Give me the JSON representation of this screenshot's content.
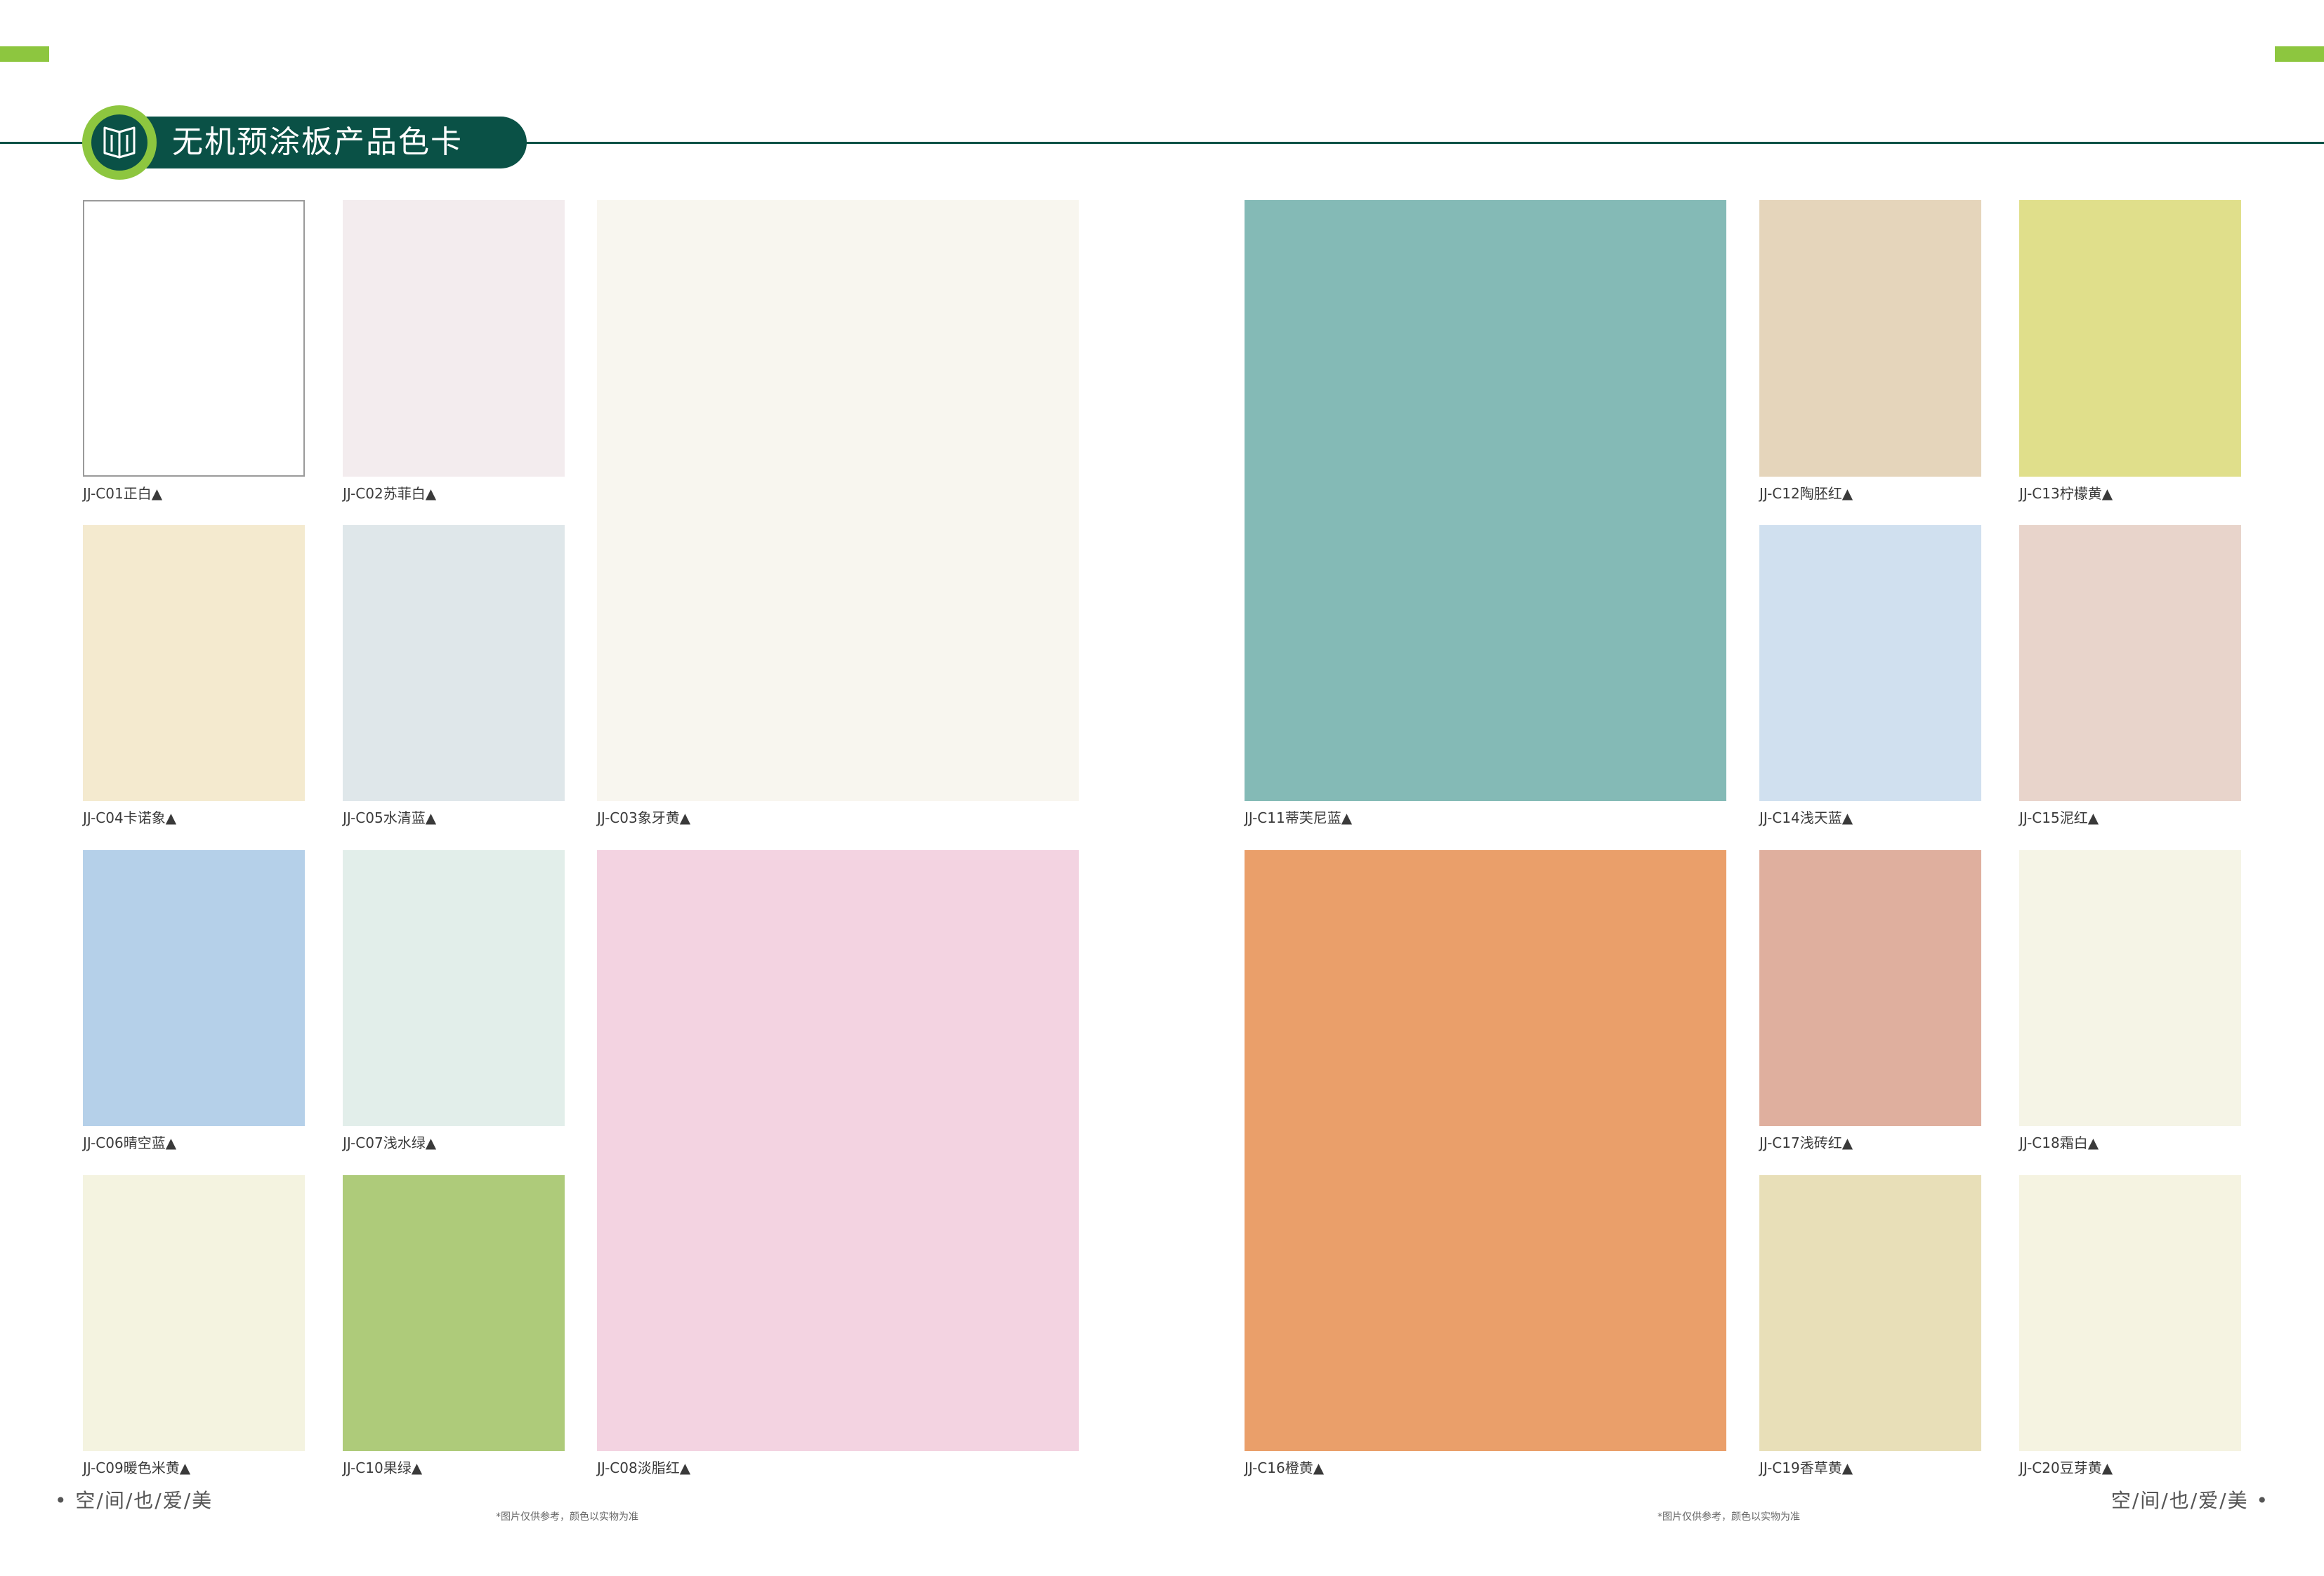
{
  "header": {
    "title": "无机预涂板产品色卡",
    "icon": "open-book-icon"
  },
  "colors": {
    "brand_green": "#0a5146",
    "accent_green": "#8dc63f"
  },
  "swatches": [
    {
      "code": "JJ-C01",
      "label": "JJ-C01正白▲",
      "color": "#ffffff",
      "bordered": true
    },
    {
      "code": "JJ-C02",
      "label": "JJ-C02苏菲白▲",
      "color": "#f3ecee"
    },
    {
      "code": "JJ-C03",
      "label": "JJ-C03象牙黄▲",
      "color": "#f8f6ef"
    },
    {
      "code": "JJ-C04",
      "label": "JJ-C04卡诺象▲",
      "color": "#f4eacf"
    },
    {
      "code": "JJ-C05",
      "label": "JJ-C05水清蓝▲",
      "color": "#dfe7ea"
    },
    {
      "code": "JJ-C06",
      "label": "JJ-C06晴空蓝▲",
      "color": "#b5d0e9"
    },
    {
      "code": "JJ-C07",
      "label": "JJ-C07浅水绿▲",
      "color": "#e2eeea"
    },
    {
      "code": "JJ-C08",
      "label": "JJ-C08淡脂红▲",
      "color": "#f3d3e1"
    },
    {
      "code": "JJ-C09",
      "label": "JJ-C09暖色米黄▲",
      "color": "#f4f3e0"
    },
    {
      "code": "JJ-C10",
      "label": "JJ-C10果绿▲",
      "color": "#aecb7a"
    },
    {
      "code": "JJ-C11",
      "label": "JJ-C11蒂芙尼蓝▲",
      "color": "#84bab6"
    },
    {
      "code": "JJ-C12",
      "label": "JJ-C12陶胚红▲",
      "color": "#e5d5bb"
    },
    {
      "code": "JJ-C13",
      "label": "JJ-C13柠檬黄▲",
      "color": "#e0df8b"
    },
    {
      "code": "JJ-C14",
      "label": "JJ-C14浅天蓝▲",
      "color": "#d0e0ef"
    },
    {
      "code": "JJ-C15",
      "label": "JJ-C15泥红▲",
      "color": "#e8d4cb"
    },
    {
      "code": "JJ-C16",
      "label": "JJ-C16橙黄▲",
      "color": "#ea9f6a"
    },
    {
      "code": "JJ-C17",
      "label": "JJ-C17浅砖红▲",
      "color": "#dfaf9e"
    },
    {
      "code": "JJ-C18",
      "label": "JJ-C18霜白▲",
      "color": "#f5f4e6"
    },
    {
      "code": "JJ-C19",
      "label": "JJ-C19香草黄▲",
      "color": "#e8dfb8"
    },
    {
      "code": "JJ-C20",
      "label": "JJ-C20豆芽黄▲",
      "color": "#f5f3e1"
    }
  ],
  "footer": {
    "left": "• 空/间/也/爱/美",
    "right": "空/间/也/爱/美 •",
    "disclaimer_left": "*图片仅供参考，颜色以实物为准",
    "disclaimer_right": "*图片仅供参考，颜色以实物为准"
  }
}
